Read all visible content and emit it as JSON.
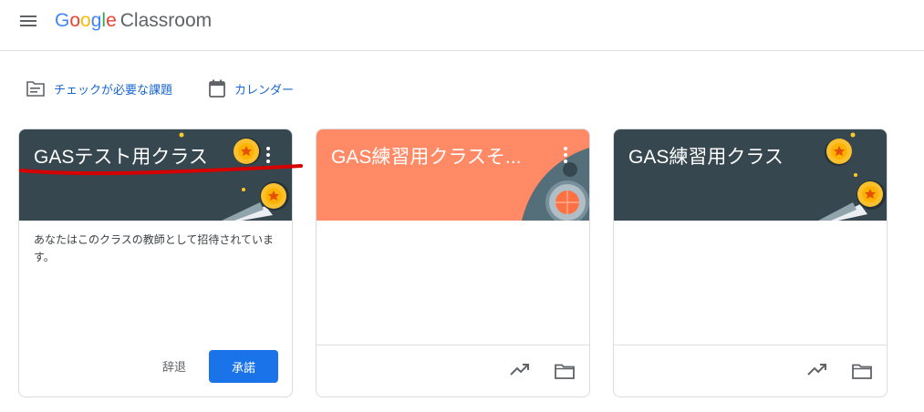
{
  "app": {
    "logo_google": "Google",
    "logo_product": "Classroom"
  },
  "toolbar": {
    "todo_label": "チェックが必要な課題",
    "calendar_label": "カレンダー"
  },
  "cards": [
    {
      "title": "GASテスト用クラス",
      "header_color": "#37474f",
      "invite_text": "あなたはこのクラスの教師として招待されています。",
      "decline_label": "辞退",
      "accept_label": "承諾"
    },
    {
      "title": "GAS練習用クラスそ...",
      "header_color": "#ff8a65"
    },
    {
      "title": "GAS練習用クラス",
      "header_color": "#37474f"
    }
  ],
  "colors": {
    "accent": "#1a73e8",
    "link": "#1967d2",
    "annotation": "#d50000"
  },
  "icons": [
    "menu-icon",
    "assignment-icon",
    "calendar-icon",
    "more-vert-icon",
    "trending-up-icon",
    "folder-icon"
  ]
}
